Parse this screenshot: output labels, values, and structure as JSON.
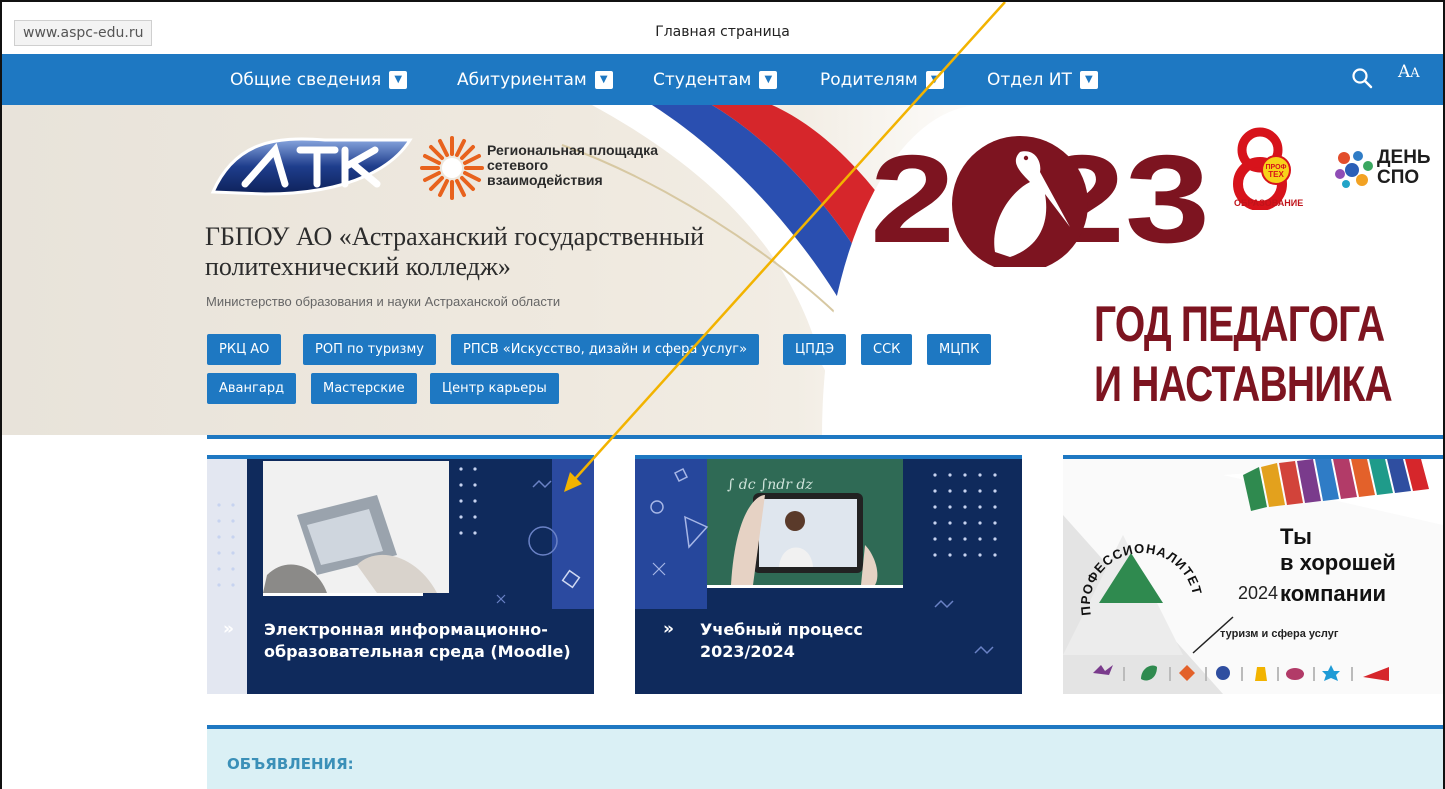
{
  "browser": {
    "url": "www.aspc-edu.ru",
    "page_title": "Главная страница"
  },
  "nav": {
    "items": [
      {
        "label": "Общие сведения"
      },
      {
        "label": "Абитуриентам"
      },
      {
        "label": "Студентам"
      },
      {
        "label": "Родителям"
      },
      {
        "label": "Отдел ИТ"
      }
    ],
    "search_icon": "search-icon",
    "font_size_label": "AA"
  },
  "hero": {
    "regional_platform": "Региональная площадка сетевого взаимодействия",
    "org_title_line1": "ГБПОУ АО «Астраханский государственный",
    "org_title_line2": "политехнический колледж»",
    "ministry": "Министерство образования и науки Астраханской области",
    "chips": [
      "РКЦ АО",
      "РОП по туризму",
      "РПСВ «Искусство, дизайн и сфера услуг»",
      "ЦПДЭ",
      "ССК",
      "МЦПК",
      "Авангард",
      "Мастерские",
      "Центр карьеры"
    ],
    "year": "2023",
    "slogan_line1": "ГОД ПЕДАГОГА",
    "slogan_line2": "И НАСТАВНИКА",
    "edu_logo_text": "ОБРАЗОВАНИЕ",
    "spo_line1": "ДЕНЬ",
    "spo_line2": "СПО"
  },
  "cards": [
    {
      "title_line1": "Электронная информационно-",
      "title_line2": "образовательная среда (Moodle)"
    },
    {
      "title_line1": "Учебный процесс",
      "title_line2": "2023/2024"
    },
    {
      "arc_text": "ПРОФЕССИОНАЛИТЕТ",
      "title_line1": "Ты",
      "title_line2": "в хорошей",
      "title_line3": "компании",
      "year": "2024",
      "subtitle": "туризм и сфера услуг"
    }
  ],
  "announcements": {
    "title": "ОБЪЯВЛЕНИЯ:"
  },
  "colors": {
    "primary": "#1e78c2",
    "card_navy": "#0f2a5c",
    "slogan": "#7d1420",
    "annotation_arrow": "#f2b300"
  }
}
